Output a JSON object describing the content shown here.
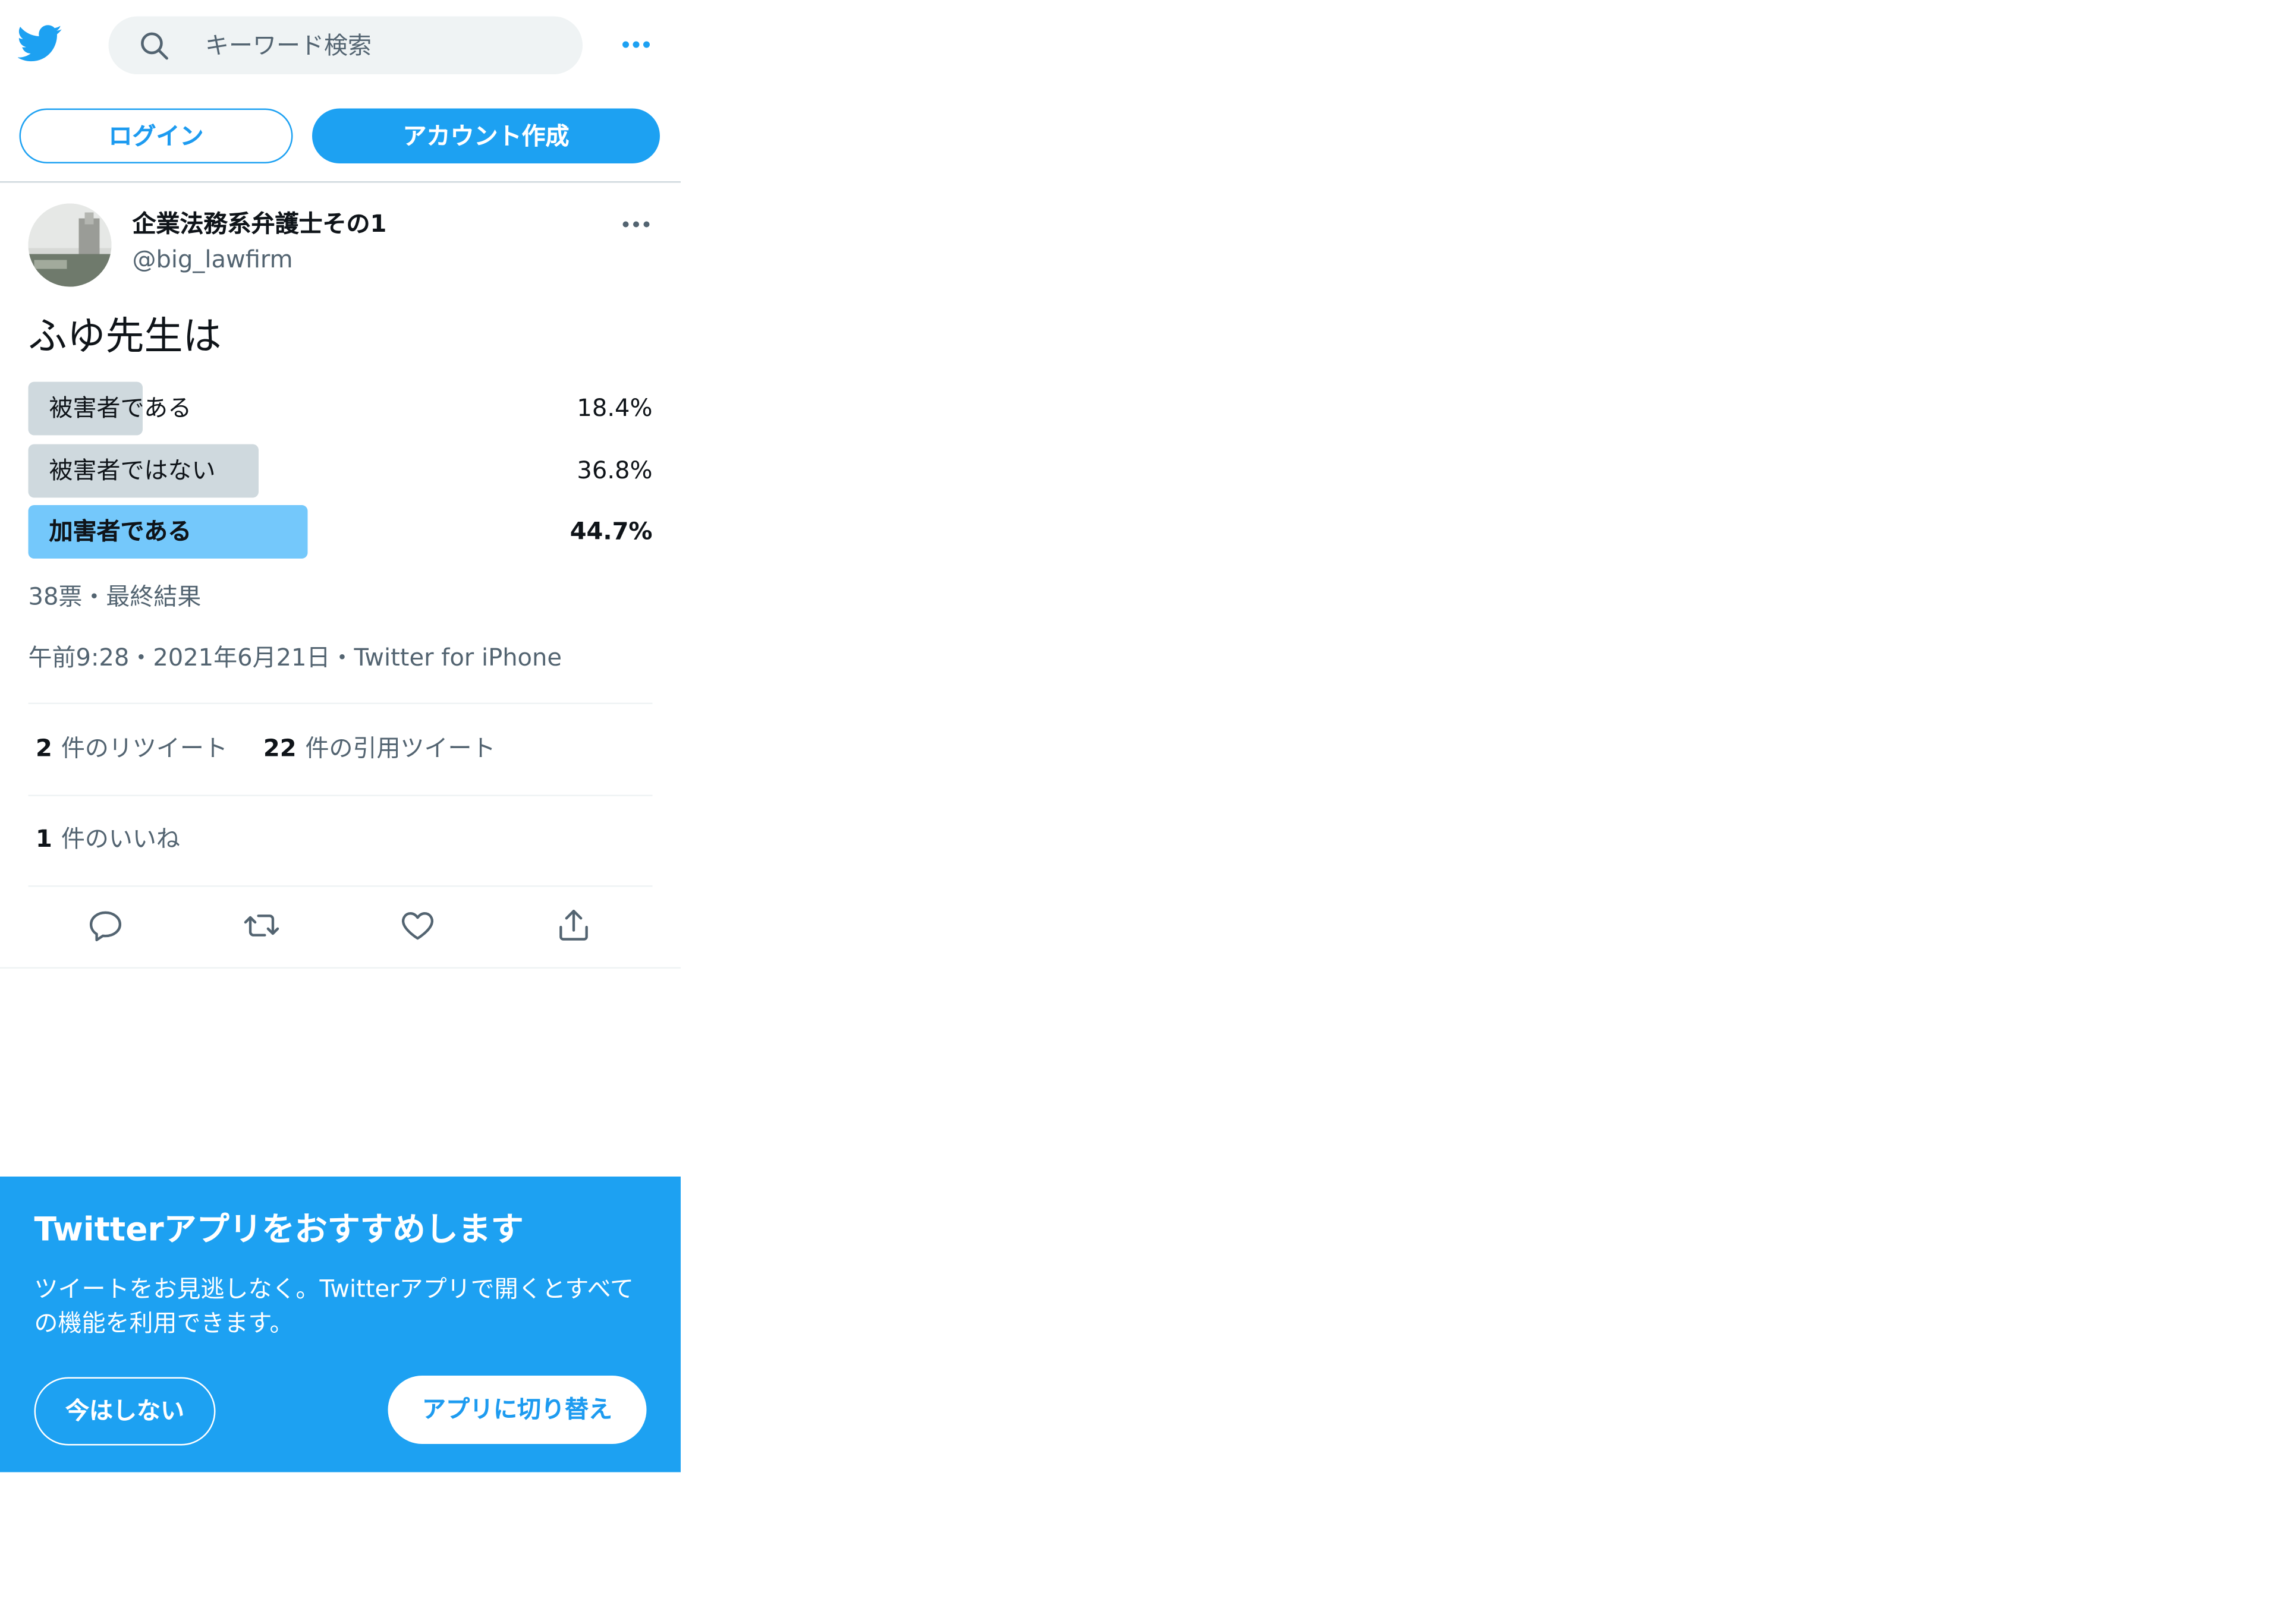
{
  "colors": {
    "brand": "#1da1f2",
    "poll_winner": "#74c8fb",
    "poll_other": "#cfd9de",
    "secondary_text": "#536471"
  },
  "header": {
    "logo_icon": "twitter-bird-icon",
    "search_placeholder": "キーワード検索",
    "more_icon": "more-dots-icon",
    "login_label": "ログイン",
    "signup_label": "アカウント作成"
  },
  "tweet": {
    "display_name": "企業法務系弁護士その1",
    "handle": "@big_lawfirm",
    "text": "ふゆ先生は",
    "poll": {
      "options": [
        {
          "label": "被害者である",
          "percent": "18.4%",
          "value": 18.4
        },
        {
          "label": "被害者ではない",
          "percent": "36.8%",
          "value": 36.8
        },
        {
          "label": "加害者である",
          "percent": "44.7%",
          "value": 44.7
        }
      ],
      "meta": "38票・最終結果"
    },
    "timestamp": "午前9:28・2021年6月21日・Twitter for iPhone",
    "stats": {
      "retweets_count": "2",
      "retweets_label": "件のリツイート",
      "quotes_count": "22",
      "quotes_label": "件の引用ツイート",
      "likes_count": "1",
      "likes_label": "件のいいね"
    },
    "actions": [
      "reply-icon",
      "retweet-icon",
      "like-icon",
      "share-icon"
    ]
  },
  "banner": {
    "title": "Twitterアプリをおすすめします",
    "body": "ツイートをお見逃しなく。Twitterアプリで開くとすべての機能を利用できます。",
    "later_label": "今はしない",
    "open_app_label": "アプリに切り替え"
  }
}
